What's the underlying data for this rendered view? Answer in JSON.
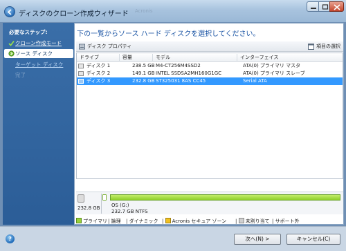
{
  "window": {
    "title": "ディスクのクローン作成ウィザード",
    "ghost_text": "Acronis"
  },
  "sidebar": {
    "title": "必要なステップ:",
    "steps": [
      {
        "label": "クローン作成モード",
        "state": "done"
      },
      {
        "label": "ソース ディスク",
        "state": "current"
      },
      {
        "label": "ターゲット ディスク",
        "state": "next"
      },
      {
        "label": "完了",
        "state": "disabled"
      }
    ]
  },
  "main": {
    "heading": "下の一覧からソース ハード ディスクを選択してください。",
    "toolbar": {
      "properties_label": "ディスク プロパティ",
      "columns_label": "項目の選択"
    },
    "table": {
      "columns": [
        "ドライブ",
        "容量",
        "モデル",
        "インターフェイス"
      ],
      "rows": [
        {
          "drive": "ディスク 1",
          "capacity": "238.5 GB",
          "model": "M4-CT256M4SSD2",
          "interface": "ATA(0) プライマリ マスタ",
          "selected": false
        },
        {
          "drive": "ディスク 2",
          "capacity": "149.1 GB",
          "model": "INTEL SSDSA2MH160G1GC",
          "interface": "ATA(0) プライマリ スレーブ",
          "selected": false
        },
        {
          "drive": "ディスク 3",
          "capacity": "232.8 GB",
          "model": "ST325031 8AS CC45",
          "interface": "Serial ATA",
          "selected": true
        }
      ]
    },
    "disk_map": {
      "disk_size": "232.8 GB",
      "partition_label": "OS (G:)",
      "partition_detail": "232.7 GB  NTFS"
    },
    "legend": [
      {
        "label": "プライマリ",
        "color": "#9ad23a"
      },
      {
        "label": "論理",
        "color": null
      },
      {
        "label": "ダイナミック",
        "color": null
      },
      {
        "label": "Acronis セキュア ゾーン",
        "color": "#f0c020"
      },
      {
        "label": "未割り当て",
        "color": "#d0d0d0"
      },
      {
        "label": "サポート外",
        "color": null
      }
    ]
  },
  "footer": {
    "help_icon": "help-icon",
    "next_label": "次へ(N) >",
    "cancel_label": "キャンセル(C)"
  },
  "colors": {
    "accent": "#1d56a5",
    "selection": "#3399ff",
    "sidebar": "#2b5d97"
  }
}
